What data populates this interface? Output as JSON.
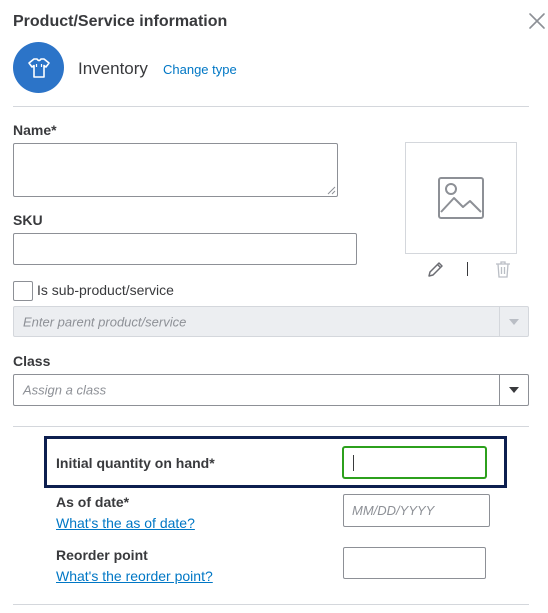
{
  "header": {
    "title": "Product/Service information",
    "close_icon": "close-icon"
  },
  "type": {
    "icon": "shirt-icon",
    "icon_bg": "#2c74c8",
    "name": "Inventory",
    "change_link": "Change type"
  },
  "form": {
    "name_label": "Name*",
    "name_value": "",
    "sku_label": "SKU",
    "sku_value": "",
    "sub_product_label": "Is sub-product/service",
    "sub_product_checked": false,
    "parent_placeholder": "Enter parent product/service",
    "class_label": "Class",
    "class_placeholder": "Assign a class"
  },
  "image": {
    "placeholder_icon": "image-placeholder-icon",
    "edit_icon": "pencil-icon",
    "delete_icon": "trash-icon"
  },
  "inventory": {
    "initial_qty_label": "Initial quantity on hand*",
    "initial_qty_value": "",
    "as_of_label": "As of date*",
    "as_of_help": "What's the as of date?",
    "as_of_placeholder": "MM/DD/YYYY",
    "reorder_label": "Reorder point",
    "reorder_help": "What's the reorder point?",
    "reorder_value": ""
  },
  "colors": {
    "link": "#0077c5",
    "focus_border": "#2ca01c",
    "highlight_border": "#0d1f4f"
  }
}
